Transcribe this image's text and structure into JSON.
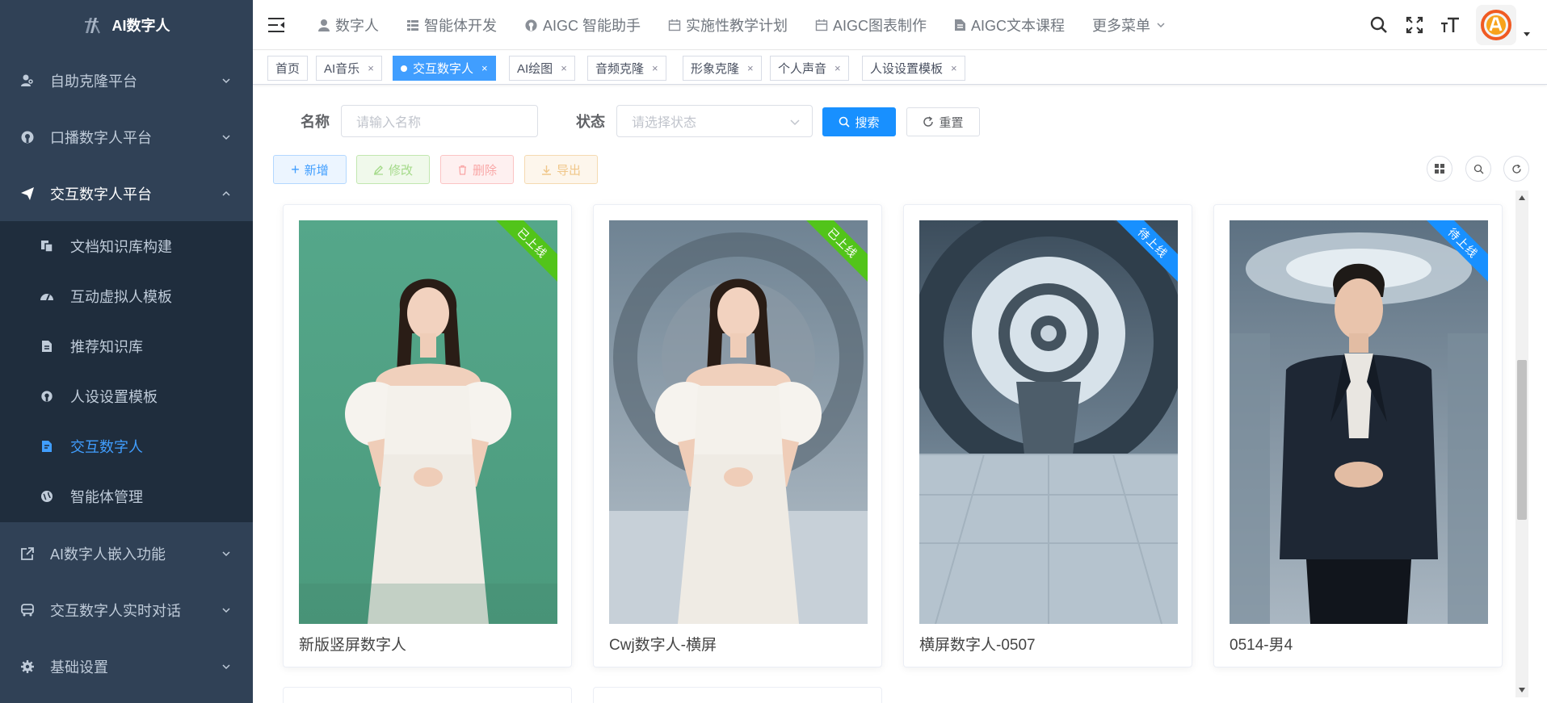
{
  "app": {
    "title": "AI数字人"
  },
  "sidebar": {
    "items": [
      {
        "label": "自助克隆平台",
        "icon": "user-clone-icon"
      },
      {
        "label": "口播数字人平台",
        "icon": "github-icon"
      },
      {
        "label": "交互数字人平台",
        "icon": "paper-plane-icon"
      },
      {
        "label": "AI数字人嵌入功能",
        "icon": "external-link-icon"
      },
      {
        "label": "交互数字人实时对话",
        "icon": "bus-icon"
      },
      {
        "label": "基础设置",
        "icon": "gear-icon"
      }
    ],
    "submenu": [
      {
        "label": "文档知识库构建",
        "icon": "copy-icon"
      },
      {
        "label": "互动虚拟人模板",
        "icon": "dashboard-icon"
      },
      {
        "label": "推荐知识库",
        "icon": "file-icon"
      },
      {
        "label": "人设设置模板",
        "icon": "github-icon"
      },
      {
        "label": "交互数字人",
        "icon": "edit-doc-icon"
      },
      {
        "label": "智能体管理",
        "icon": "globe-icon"
      }
    ]
  },
  "navbar": {
    "items": [
      {
        "label": "数字人",
        "icon": "user-icon"
      },
      {
        "label": "智能体开发",
        "icon": "list-icon"
      },
      {
        "label": "AIGC 智能助手",
        "icon": "github-icon"
      },
      {
        "label": "实施性教学计划",
        "icon": "calendar-icon"
      },
      {
        "label": "AIGC图表制作",
        "icon": "calendar-icon"
      },
      {
        "label": "AIGC文本课程",
        "icon": "document-icon"
      },
      {
        "label": "更多菜单",
        "icon": "chevron-down-icon"
      }
    ]
  },
  "tags": [
    {
      "label": "首页",
      "closable": false,
      "active": false
    },
    {
      "label": "AI音乐",
      "closable": true,
      "active": false
    },
    {
      "label": "交互数字人",
      "closable": true,
      "active": true
    },
    {
      "label": "AI绘图",
      "closable": true,
      "active": false
    },
    {
      "label": "音频克隆",
      "closable": true,
      "active": false
    },
    {
      "label": "形象克隆",
      "closable": true,
      "active": false
    },
    {
      "label": "个人声音",
      "closable": true,
      "active": false
    },
    {
      "label": "人设设置模板",
      "closable": true,
      "active": false
    }
  ],
  "tag_close_glyph": "×",
  "search": {
    "name_label": "名称",
    "name_placeholder": "请输入名称",
    "status_label": "状态",
    "status_placeholder": "请选择状态",
    "search_button": "搜索",
    "reset_button": "重置"
  },
  "toolbar": {
    "add": "新增",
    "edit": "修改",
    "delete": "删除",
    "export": "导出"
  },
  "cards": [
    {
      "title": "新版竖屏数字人",
      "status": "已上线",
      "status_color": "#52c41a"
    },
    {
      "title": "Cwj数字人-横屏",
      "status": "已上线",
      "status_color": "#52c41a"
    },
    {
      "title": "横屏数字人-0507",
      "status": "待上线",
      "status_color": "#1890ff"
    },
    {
      "title": "0514-男4",
      "status": "待上线",
      "status_color": "#1890ff"
    }
  ],
  "colors": {
    "sidebar_bg": "#304156",
    "submenu_bg": "#1f2d3d",
    "accent": "#409eff",
    "primary": "#1890ff",
    "online": "#52c41a",
    "pending": "#1890ff"
  }
}
